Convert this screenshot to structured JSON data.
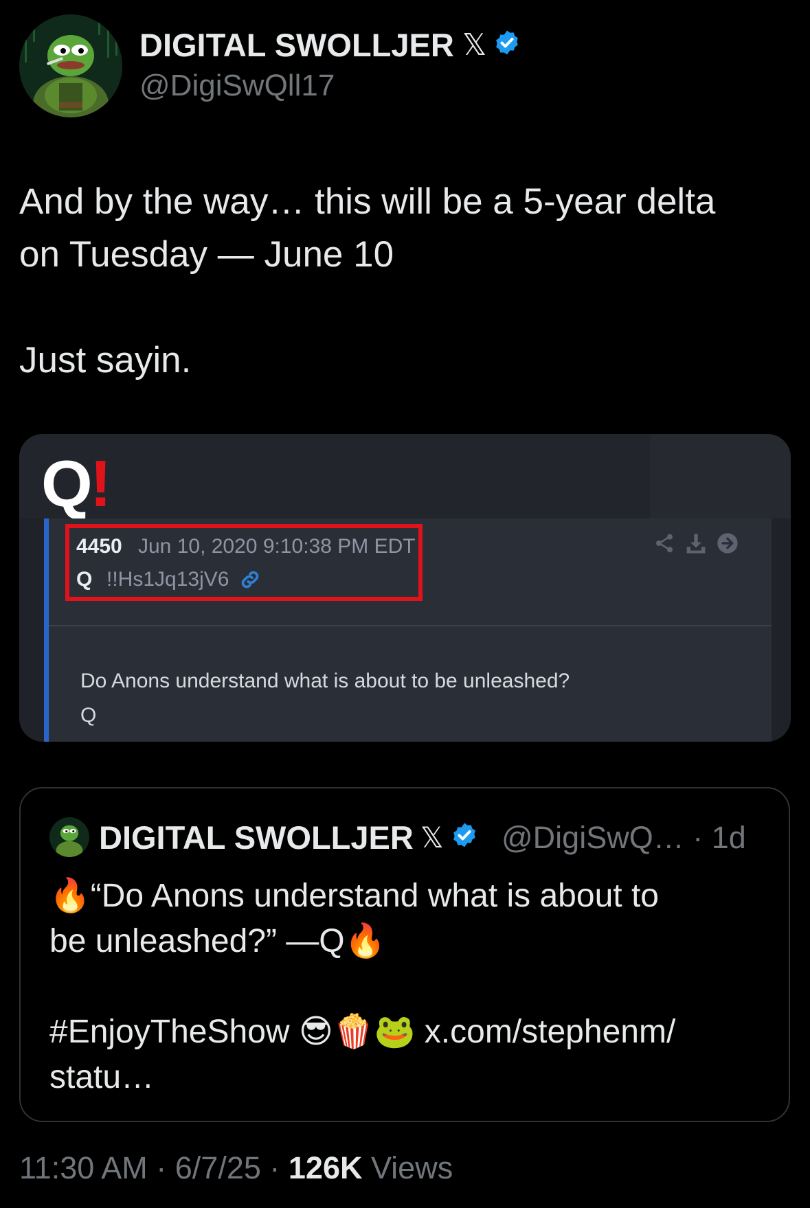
{
  "author": {
    "name": "DIGITAL SWOLLJER",
    "x_mark": "𝕏",
    "handle": "@DigiSwQll17"
  },
  "tweet": {
    "line1": "And by the way… this will be a 5-year delta",
    "line2": "on Tuesday — June 10",
    "line3": "Just sayin."
  },
  "media": {
    "logo_q": "Q",
    "logo_bang": "!",
    "post_number": "4450",
    "post_date": "Jun 10, 2020 9:10:38 PM EDT",
    "post_author": "Q",
    "tripcode": "!!Hs1Jq13jV6",
    "post_text": "Do Anons understand what is about to be unleashed?",
    "post_sign": "Q",
    "highlight_color": "#e0121a"
  },
  "quoted": {
    "name": "DIGITAL SWOLLJER",
    "x_mark": "𝕏",
    "handle_time": "@DigiSwQ… · 1d",
    "line1": "🔥“Do Anons understand what is about to",
    "line2": "be unleashed?” —Q🔥",
    "line3": "#EnjoyTheShow 😎🍿🐸 x.com/stephenm/",
    "line4": "statu…"
  },
  "footer": {
    "time_date": "11:30 AM · 6/7/25 · ",
    "views_count": "126K",
    "views_label": " Views"
  },
  "colors": {
    "background": "#000000",
    "verified": "#1d9bf0",
    "secondary_text": "#71767b"
  }
}
